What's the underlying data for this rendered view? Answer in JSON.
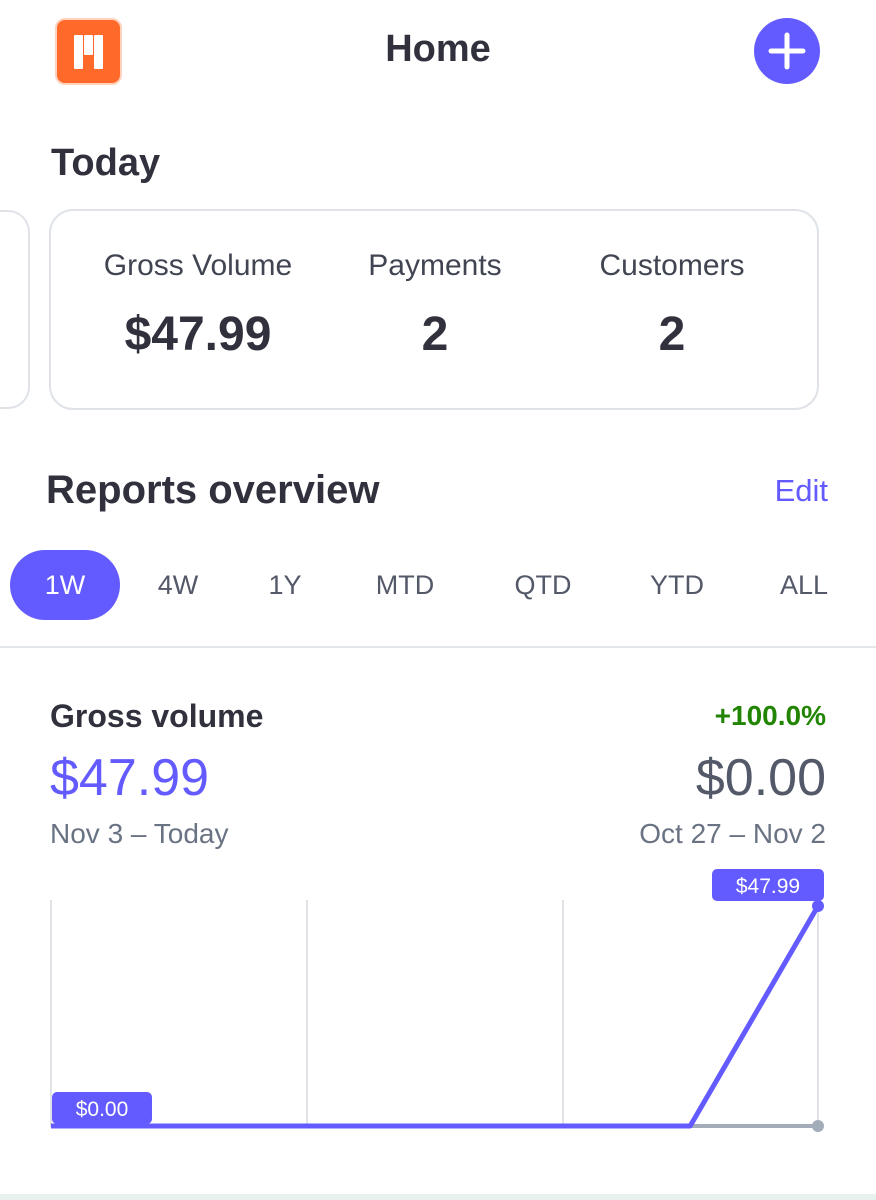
{
  "header": {
    "title": "Home",
    "logo_icon": "stripe-bars-logo",
    "add_icon": "plus-icon",
    "accent_color": "#635bff",
    "logo_color": "#ff6a2b"
  },
  "today": {
    "heading": "Today",
    "stats": [
      {
        "label": "Gross Volume",
        "value": "$47.99"
      },
      {
        "label": "Payments",
        "value": "2"
      },
      {
        "label": "Customers",
        "value": "2"
      }
    ]
  },
  "reports": {
    "heading": "Reports overview",
    "edit_label": "Edit",
    "tabs": [
      "1W",
      "4W",
      "1Y",
      "MTD",
      "QTD",
      "YTD",
      "ALL"
    ],
    "active_tab": "1W"
  },
  "gross_volume": {
    "label": "Gross volume",
    "change": "+100.0%",
    "change_color": "#228403",
    "current_value": "$47.99",
    "previous_value": "$0.00",
    "current_range": "Nov 3 – Today",
    "previous_range": "Oct 27 – Nov 2"
  },
  "chart_data": {
    "type": "line",
    "x": [
      0,
      1,
      2,
      3,
      4,
      5,
      6
    ],
    "series": [
      {
        "values": [
          0,
          0,
          0,
          0,
          0,
          0,
          47.99
        ],
        "color": "#635bff"
      },
      {
        "values": [
          0,
          0,
          0,
          0,
          0,
          0,
          0
        ],
        "color": "#a3acb9"
      }
    ],
    "ylim": [
      0,
      47.99
    ],
    "grid": "vertical",
    "start_label": "$0.00",
    "end_label": "$47.99"
  }
}
